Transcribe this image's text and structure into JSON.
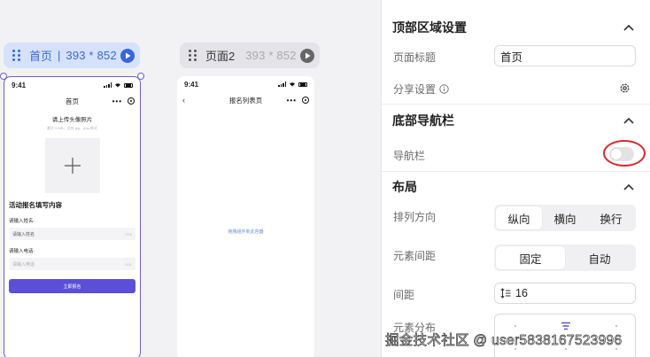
{
  "canvas": {
    "page1": {
      "name": "首页",
      "separator": "|",
      "size": "393 * 852"
    },
    "page2": {
      "name": "页面2",
      "size": "393 * 852"
    }
  },
  "phone1": {
    "time": "9:41",
    "nav_title": "首页",
    "upload_title": "请上传头像照片",
    "upload_hint": "最大 5 MB，支持 jpg、png 格式",
    "form_heading": "活动报名填写内容",
    "name_label": "请输入姓名·",
    "name_placeholder": "请输入姓名",
    "name_count": "0/34",
    "phone_label": "请输入电话·",
    "phone_placeholder": "请输入电话",
    "phone_count": "0/11",
    "submit_label": "立即报名"
  },
  "phone2": {
    "time": "9:41",
    "nav_title": "报名列表页",
    "empty_hint": "拖拽组件到此容器"
  },
  "panel": {
    "top_section": {
      "title": "顶部区域设置",
      "page_title_label": "页面标题",
      "page_title_value": "首页",
      "share_label": "分享设置"
    },
    "bottom_nav_section": {
      "title": "底部导航栏",
      "nav_label": "导航栏",
      "nav_enabled": false
    },
    "layout_section": {
      "title": "布局",
      "direction_label": "排列方向",
      "direction_options": [
        "纵向",
        "横向",
        "换行"
      ],
      "direction_selected": "纵向",
      "spacing_label": "元素间距",
      "spacing_options": [
        "固定",
        "自动"
      ],
      "spacing_selected": "固定",
      "gap_label": "间距",
      "gap_value": "16",
      "distribution_label": "元素分布"
    }
  },
  "watermark": "掘金技术社区 @ user5838167523996",
  "colors": {
    "accent": "#3a66d9",
    "submit": "#5b4fd8",
    "highlight_ring": "#e0262b"
  }
}
